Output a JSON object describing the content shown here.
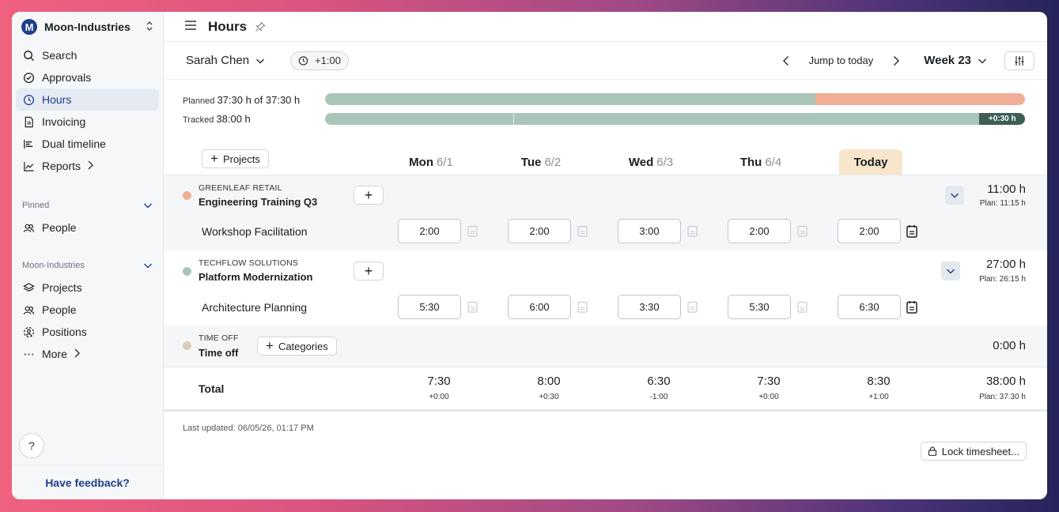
{
  "workspace": {
    "name": "Moon-Industries",
    "initial": "M"
  },
  "nav": [
    {
      "label": "Search",
      "icon": "search-icon"
    },
    {
      "label": "Approvals",
      "icon": "check-circle-icon"
    },
    {
      "label": "Hours",
      "icon": "clock-icon",
      "active": true
    },
    {
      "label": "Invoicing",
      "icon": "document-icon"
    },
    {
      "label": "Dual timeline",
      "icon": "timeline-icon"
    },
    {
      "label": "Reports",
      "icon": "chart-icon"
    }
  ],
  "pinned": {
    "title": "Pinned",
    "items": [
      {
        "label": "People",
        "icon": "people-icon"
      }
    ]
  },
  "org": {
    "title": "Moon-Industries",
    "items": [
      {
        "label": "Projects",
        "icon": "layers-icon"
      },
      {
        "label": "People",
        "icon": "people-icon"
      },
      {
        "label": "Positions",
        "icon": "positions-icon"
      },
      {
        "label": "More",
        "icon": "ellipsis-icon"
      }
    ]
  },
  "help_label": "?",
  "feedback_label": "Have feedback?",
  "page_title": "Hours",
  "toolbar": {
    "user": "Sarah Chen",
    "offset": "+1:00",
    "jump": "Jump to today",
    "week": "Week 23"
  },
  "summary": {
    "planned_label": "Planned",
    "planned_value": "37:30 h of 37:30 h",
    "planned_fraction": 0.7,
    "tracked_label": "Tracked",
    "tracked_value": "38:00 h",
    "tracked_fraction": 0.935,
    "tracked_sep_fraction": 0.269,
    "overtime_badge": "+0:30 h"
  },
  "projects_button": "Projects",
  "days": [
    {
      "name": "Mon",
      "date": "6/1"
    },
    {
      "name": "Tue",
      "date": "6/2"
    },
    {
      "name": "Wed",
      "date": "6/3"
    },
    {
      "name": "Thu",
      "date": "6/4"
    },
    {
      "name": "Today",
      "date": ""
    }
  ],
  "projects": [
    {
      "client": "GREENLEAF RETAIL",
      "name": "Engineering Training Q3",
      "dot_color": "#f0ae97",
      "total": "11:00 h",
      "plan": "Plan: 11:15 h",
      "task": "Workshop Facilitation",
      "hours": [
        "2:00",
        "2:00",
        "3:00",
        "2:00",
        "2:00"
      ]
    },
    {
      "client": "TECHFLOW SOLUTIONS",
      "name": "Platform Modernization",
      "dot_color": "#a9c6b8",
      "total": "27:00 h",
      "plan": "Plan: 26:15 h",
      "task": "Architecture Planning",
      "hours": [
        "5:30",
        "6:00",
        "3:30",
        "5:30",
        "6:30"
      ]
    }
  ],
  "time_off": {
    "client": "TIME OFF",
    "name": "Time off",
    "dot_color": "#d8ccba",
    "button": "Categories",
    "total": "0:00 h"
  },
  "totals": {
    "label": "Total",
    "values": [
      "7:30",
      "8:00",
      "6:30",
      "7:30",
      "8:30"
    ],
    "diffs": [
      "+0:00",
      "+0:30",
      "-1:00",
      "+0:00",
      "+1:00"
    ],
    "grand": "38:00 h",
    "grand_plan": "Plan: 37:30 h"
  },
  "last_updated": "Last updated: 06/05/26, 01:17 PM",
  "lock_button": "Lock timesheet..."
}
